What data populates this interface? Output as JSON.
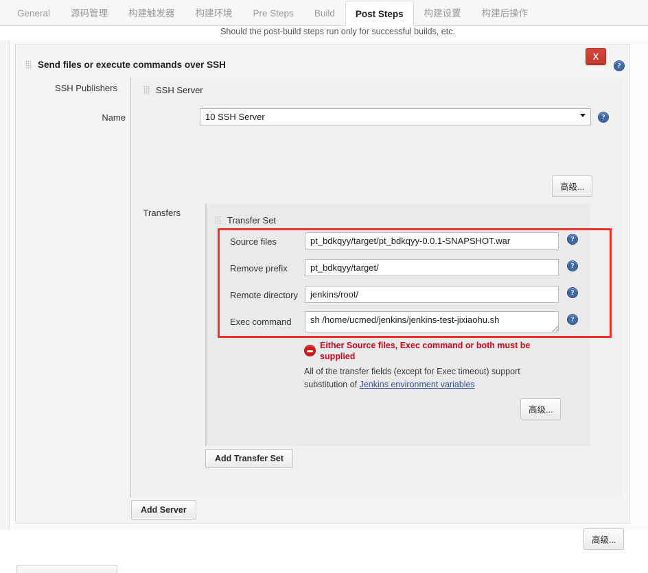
{
  "tabs": [
    {
      "label": "General",
      "active": false
    },
    {
      "label": "源码管理",
      "active": false
    },
    {
      "label": "构建触发器",
      "active": false
    },
    {
      "label": "构建环境",
      "active": false
    },
    {
      "label": "Pre Steps",
      "active": false
    },
    {
      "label": "Build",
      "active": false
    },
    {
      "label": "Post Steps",
      "active": true
    },
    {
      "label": "构建设置",
      "active": false
    },
    {
      "label": "构建后操作",
      "active": false
    }
  ],
  "page": {
    "description": "Should the post-build steps run only for successful builds, etc."
  },
  "builder": {
    "title": "Send files or execute commands over SSH",
    "close_label": "X",
    "help_glyph": "?"
  },
  "publishers": {
    "label": "SSH Publishers"
  },
  "ssh_server": {
    "title": "SSH Server",
    "name_label": "Name",
    "name_value": "10 SSH Server",
    "advanced_label": "高级..."
  },
  "transfers": {
    "label": "Transfers",
    "set_title": "Transfer Set",
    "fields": [
      {
        "label": "Source files",
        "value": "pt_bdkqyy/target/pt_bdkqyy-0.0.1-SNAPSHOT.war",
        "type": "text"
      },
      {
        "label": "Remove prefix",
        "value": "pt_bdkqyy/target/",
        "type": "text"
      },
      {
        "label": "Remote directory",
        "value": "jenkins/root/",
        "type": "text"
      },
      {
        "label": "Exec command",
        "value": "sh /home/ucmed/jenkins/jenkins-test-jixiaohu.sh",
        "type": "textarea"
      }
    ],
    "error_message": "Either Source files, Exec command or both must be supplied",
    "note_prefix": "All of the transfer fields (except for Exec timeout) support substitution of ",
    "note_link": "Jenkins environment variables",
    "advanced_label": "高级...",
    "add_transfer_set_label": "Add Transfer Set"
  },
  "footer": {
    "add_server_label": "Add Server",
    "advanced_label": "高级..."
  },
  "colors": {
    "accent_red": "#ef3124",
    "error_red": "#d0021b",
    "help_blue": "#3e68a8",
    "link_blue": "#2b4f9e"
  }
}
